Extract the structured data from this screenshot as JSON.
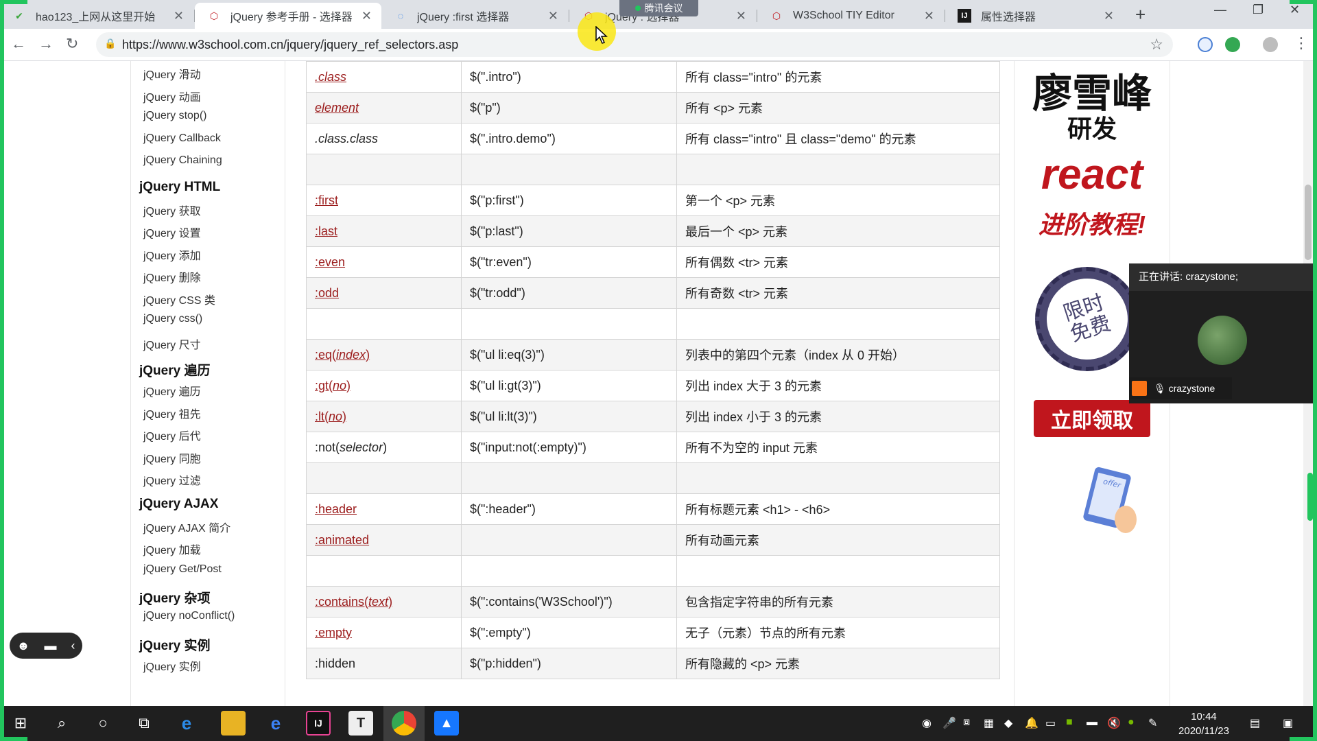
{
  "browser": {
    "tabs": [
      {
        "title": "hao123_上网从这里开始",
        "icon": "hao123-icon"
      },
      {
        "title": "jQuery 参考手册 - 选择器",
        "icon": "w3school-icon"
      },
      {
        "title": "jQuery :first 选择器",
        "icon": "loading-icon"
      },
      {
        "title": "jQuery : 选择器",
        "icon": "w3school-icon"
      },
      {
        "title": "W3School TIY Editor",
        "icon": "w3school-icon"
      },
      {
        "title": "属性选择器",
        "icon": "intellij-icon"
      }
    ],
    "url": "https://www.w3school.com.cn/jquery/jquery_ref_selectors.asp"
  },
  "meeting": {
    "pill_label": "腾讯会议",
    "speaking_label": "正在讲话: crazystone;",
    "participant_name": "crazystone"
  },
  "sidebar": {
    "items": [
      {
        "label": "jQuery 滑动",
        "type": "link"
      },
      {
        "label": "jQuery 动画",
        "type": "link"
      },
      {
        "label": "jQuery stop()",
        "type": "link"
      },
      {
        "label": "jQuery Callback",
        "type": "link"
      },
      {
        "label": "jQuery Chaining",
        "type": "link"
      },
      {
        "label": "jQuery HTML",
        "type": "heading"
      },
      {
        "label": "jQuery 获取",
        "type": "link"
      },
      {
        "label": "jQuery 设置",
        "type": "link"
      },
      {
        "label": "jQuery 添加",
        "type": "link"
      },
      {
        "label": "jQuery 删除",
        "type": "link"
      },
      {
        "label": "jQuery CSS 类",
        "type": "link"
      },
      {
        "label": "jQuery css()",
        "type": "link"
      },
      {
        "label": "jQuery 尺寸",
        "type": "link"
      },
      {
        "label": "jQuery 遍历",
        "type": "heading"
      },
      {
        "label": "jQuery 遍历",
        "type": "link"
      },
      {
        "label": "jQuery 祖先",
        "type": "link"
      },
      {
        "label": "jQuery 后代",
        "type": "link"
      },
      {
        "label": "jQuery 同胞",
        "type": "link"
      },
      {
        "label": "jQuery 过滤",
        "type": "link"
      },
      {
        "label": "jQuery AJAX",
        "type": "heading"
      },
      {
        "label": "jQuery AJAX 简介",
        "type": "link"
      },
      {
        "label": "jQuery 加载",
        "type": "link"
      },
      {
        "label": "jQuery Get/Post",
        "type": "link"
      },
      {
        "label": "jQuery 杂项",
        "type": "heading"
      },
      {
        "label": "jQuery noConflict()",
        "type": "link"
      },
      {
        "label": "jQuery 实例",
        "type": "heading"
      },
      {
        "label": "jQuery 实例",
        "type": "link"
      }
    ]
  },
  "table": {
    "rows": [
      {
        "sel": ".class",
        "sel_param": "",
        "sel_link": true,
        "sel_italic": true,
        "example": "$(\".intro\")",
        "desc": "所有 class=\"intro\" 的元素"
      },
      {
        "sel": "element",
        "sel_param": "",
        "sel_link": true,
        "sel_italic": true,
        "example": "$(\"p\")",
        "desc": "所有 <p> 元素"
      },
      {
        "sel": ".class.class",
        "sel_param": "",
        "sel_link": false,
        "sel_italic": true,
        "example": "$(\".intro.demo\")",
        "desc": "所有 class=\"intro\" 且 class=\"demo\" 的元素"
      },
      {
        "sel": "",
        "sel_param": "",
        "sel_link": false,
        "sel_italic": false,
        "example": "",
        "desc": ""
      },
      {
        "sel": ":first",
        "sel_param": "",
        "sel_link": true,
        "sel_italic": false,
        "example": "$(\"p:first\")",
        "desc": "第一个 <p> 元素"
      },
      {
        "sel": ":last",
        "sel_param": "",
        "sel_link": true,
        "sel_italic": false,
        "example": "$(\"p:last\")",
        "desc": "最后一个 <p> 元素"
      },
      {
        "sel": ":even",
        "sel_param": "",
        "sel_link": true,
        "sel_italic": false,
        "example": "$(\"tr:even\")",
        "desc": "所有偶数 <tr> 元素"
      },
      {
        "sel": ":odd",
        "sel_param": "",
        "sel_link": true,
        "sel_italic": false,
        "example": "$(\"tr:odd\")",
        "desc": "所有奇数 <tr> 元素"
      },
      {
        "sel": "",
        "sel_param": "",
        "sel_link": false,
        "sel_italic": false,
        "example": "",
        "desc": ""
      },
      {
        "sel": ":eq(",
        "sel_param": "index",
        "sel_end": ")",
        "sel_link": true,
        "sel_italic": false,
        "example": "$(\"ul li:eq(3)\")",
        "desc": "列表中的第四个元素（index 从 0 开始）"
      },
      {
        "sel": ":gt(",
        "sel_param": "no",
        "sel_end": ")",
        "sel_link": true,
        "sel_italic": false,
        "example": "$(\"ul li:gt(3)\")",
        "desc": "列出 index 大于 3 的元素"
      },
      {
        "sel": ":lt(",
        "sel_param": "no",
        "sel_end": ")",
        "sel_link": true,
        "sel_italic": false,
        "example": "$(\"ul li:lt(3)\")",
        "desc": "列出 index 小于 3 的元素"
      },
      {
        "sel": ":not(",
        "sel_param": "selector",
        "sel_end": ")",
        "sel_link": false,
        "sel_italic": false,
        "example": "$(\"input:not(:empty)\")",
        "desc": "所有不为空的 input 元素"
      },
      {
        "sel": "",
        "sel_param": "",
        "sel_link": false,
        "sel_italic": false,
        "example": "",
        "desc": ""
      },
      {
        "sel": ":header",
        "sel_param": "",
        "sel_link": true,
        "sel_italic": false,
        "example": "$(\":header\")",
        "desc": "所有标题元素 <h1> - <h6>"
      },
      {
        "sel": ":animated",
        "sel_param": "",
        "sel_link": true,
        "sel_italic": false,
        "example": "",
        "desc": "所有动画元素"
      },
      {
        "sel": "",
        "sel_param": "",
        "sel_link": false,
        "sel_italic": false,
        "example": "",
        "desc": ""
      },
      {
        "sel": ":contains(",
        "sel_param": "text",
        "sel_end": ")",
        "sel_link": true,
        "sel_italic": false,
        "example": "$(\":contains('W3School')\")",
        "desc": "包含指定字符串的所有元素"
      },
      {
        "sel": ":empty",
        "sel_param": "",
        "sel_link": true,
        "sel_italic": false,
        "example": "$(\":empty\")",
        "desc": "无子（元素）节点的所有元素"
      },
      {
        "sel": ":hidden",
        "sel_param": "",
        "sel_link": false,
        "sel_italic": false,
        "example": "$(\"p:hidden\")",
        "desc": "所有隐藏的 <p> 元素"
      }
    ]
  },
  "ad": {
    "name": "廖雪峰",
    "dev": "研发",
    "react": "react",
    "advanced": "进阶教程!",
    "seal_line1": "限时",
    "seal_line2": "免费",
    "cta": "立即领取",
    "phone_text": "offer"
  },
  "taskbar": {
    "time": "10:44",
    "date": "2020/11/23"
  },
  "colors": {
    "link": "#9b1b1b",
    "share_border": "#22c55e",
    "ad_red": "#c0161d"
  }
}
